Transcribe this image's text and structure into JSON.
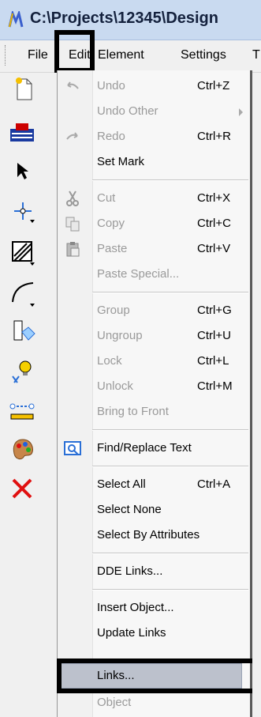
{
  "window": {
    "title": "C:\\Projects\\12345\\Design"
  },
  "menubar": {
    "items": [
      {
        "label": "File"
      },
      {
        "label": "Edit"
      },
      {
        "label": "Element"
      },
      {
        "label": "Settings"
      },
      {
        "label": "T"
      }
    ]
  },
  "edit_menu": {
    "items": [
      {
        "label": "Undo",
        "shortcut": "Ctrl+Z",
        "icon": "undo-icon"
      },
      {
        "label": "Undo Other",
        "shortcut": "",
        "icon": "submenu-arrow"
      },
      {
        "label": "Redo",
        "shortcut": "Ctrl+R",
        "icon": "redo-icon"
      },
      {
        "label": "Set Mark",
        "shortcut": ""
      },
      {
        "label": "Cut",
        "shortcut": "Ctrl+X",
        "icon": "scissors-icon"
      },
      {
        "label": "Copy",
        "shortcut": "Ctrl+C",
        "icon": "copy-icon"
      },
      {
        "label": "Paste",
        "shortcut": "Ctrl+V",
        "icon": "clipboard-icon"
      },
      {
        "label": "Paste Special...",
        "shortcut": ""
      },
      {
        "label": "Group",
        "shortcut": "Ctrl+G"
      },
      {
        "label": "Ungroup",
        "shortcut": "Ctrl+U"
      },
      {
        "label": "Lock",
        "shortcut": "Ctrl+L"
      },
      {
        "label": "Unlock",
        "shortcut": "Ctrl+M"
      },
      {
        "label": "Bring to Front",
        "shortcut": ""
      },
      {
        "label": "Find/Replace Text",
        "shortcut": "",
        "icon": "find-replace-icon"
      },
      {
        "label": "Select All",
        "shortcut": "Ctrl+A"
      },
      {
        "label": "Select None",
        "shortcut": ""
      },
      {
        "label": "Select By Attributes",
        "shortcut": ""
      },
      {
        "label": "DDE Links...",
        "shortcut": ""
      },
      {
        "label": "Insert Object...",
        "shortcut": ""
      },
      {
        "label": "Update Links",
        "shortcut": ""
      },
      {
        "label": "Links...",
        "shortcut": ""
      },
      {
        "label": "Object",
        "shortcut": ""
      }
    ]
  },
  "colors": {
    "titlebar": "#c9daf0",
    "menu_highlight": "#bcc1cc",
    "disabled_text": "#9a9a9a",
    "annotation_box": "#000000"
  }
}
